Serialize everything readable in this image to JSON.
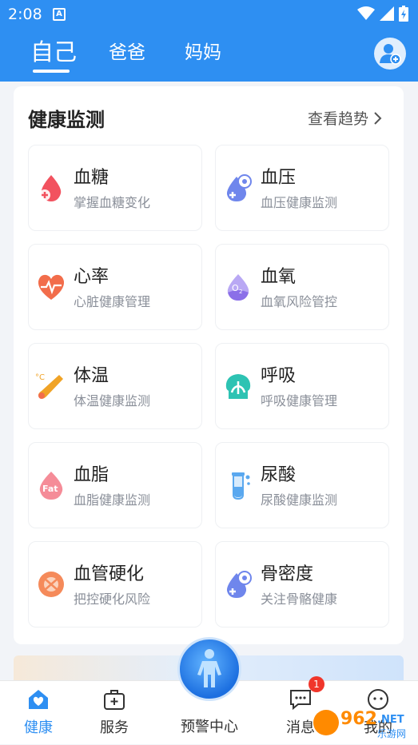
{
  "status": {
    "time": "2:08",
    "notif_icon": "A"
  },
  "header": {
    "tabs": [
      {
        "label": "自己",
        "active": true
      },
      {
        "label": "爸爸",
        "active": false
      },
      {
        "label": "妈妈",
        "active": false
      }
    ],
    "add_icon": "add-person-icon"
  },
  "monitor": {
    "title": "健康监测",
    "trend_label": "查看趋势",
    "items": [
      {
        "name": "血糖",
        "desc": "掌握血糖变化",
        "icon": "blood-sugar-icon",
        "color": "#f2525f"
      },
      {
        "name": "血压",
        "desc": "血压健康监测",
        "icon": "blood-pressure-icon",
        "color": "#6f86ec"
      },
      {
        "name": "心率",
        "desc": "心脏健康管理",
        "icon": "heart-rate-icon",
        "color": "#f26d4b"
      },
      {
        "name": "血氧",
        "desc": "血氧风险管控",
        "icon": "blood-oxygen-icon",
        "color": "#8b6fe8"
      },
      {
        "name": "体温",
        "desc": "体温健康监测",
        "icon": "thermometer-icon",
        "color": "#f0a326"
      },
      {
        "name": "呼吸",
        "desc": "呼吸健康管理",
        "icon": "breath-icon",
        "color": "#2dc3b3"
      },
      {
        "name": "血脂",
        "desc": "血脂健康监测",
        "icon": "blood-fat-icon",
        "color": "#f2667b"
      },
      {
        "name": "尿酸",
        "desc": "尿酸健康监测",
        "icon": "uric-acid-icon",
        "color": "#5aa8ef"
      },
      {
        "name": "血管硬化",
        "desc": "把控硬化风险",
        "icon": "vascular-icon",
        "color": "#f58a5a"
      },
      {
        "name": "骨密度",
        "desc": "关注骨骼健康",
        "icon": "bone-density-icon",
        "color": "#6f86ec"
      }
    ]
  },
  "tabbar": {
    "items": [
      {
        "label": "健康",
        "icon": "home-heart-icon",
        "active": true
      },
      {
        "label": "服务",
        "icon": "medical-bag-icon",
        "active": false
      },
      {
        "label": "预警中心",
        "icon": "body-scan-icon",
        "active": false
      },
      {
        "label": "消息",
        "icon": "message-icon",
        "active": false,
        "badge": "1"
      },
      {
        "label": "我的",
        "icon": "profile-icon",
        "active": false
      }
    ]
  },
  "watermark": "962.NET 乐游网"
}
